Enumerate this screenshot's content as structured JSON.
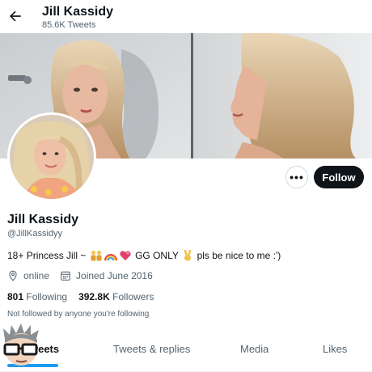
{
  "header": {
    "back_icon": "arrow-left-icon",
    "title": "Jill Kassidy",
    "tweet_count": "85.6K Tweets"
  },
  "profile": {
    "display_name": "Jill Kassidy",
    "handle": "@JillKassidyy",
    "bio_part1": "18+ Princess Jill ~",
    "bio_part2": "GG ONLY",
    "bio_part3": "pls be nice to me :')",
    "bio_emojis": [
      "couple-icon",
      "rainbow-icon",
      "hearts-icon",
      "victory-hand-icon"
    ],
    "location": "online",
    "joined": "Joined June 2016",
    "following_count": "801",
    "following_label": "Following",
    "followers_count": "392.8K",
    "followers_label": "Followers",
    "not_followed_note": "Not followed by anyone you're following"
  },
  "actions": {
    "more_label": "•••",
    "follow_label": "Follow"
  },
  "tabs": [
    {
      "label": "Tweets",
      "active": true
    },
    {
      "label": "Tweets & replies",
      "active": false
    },
    {
      "label": "Media",
      "active": false
    },
    {
      "label": "Likes",
      "active": false
    }
  ],
  "colors": {
    "accent": "#1d9bf0",
    "text_primary": "#0f1419",
    "text_secondary": "#536471",
    "follow_button": "#0f1419"
  }
}
